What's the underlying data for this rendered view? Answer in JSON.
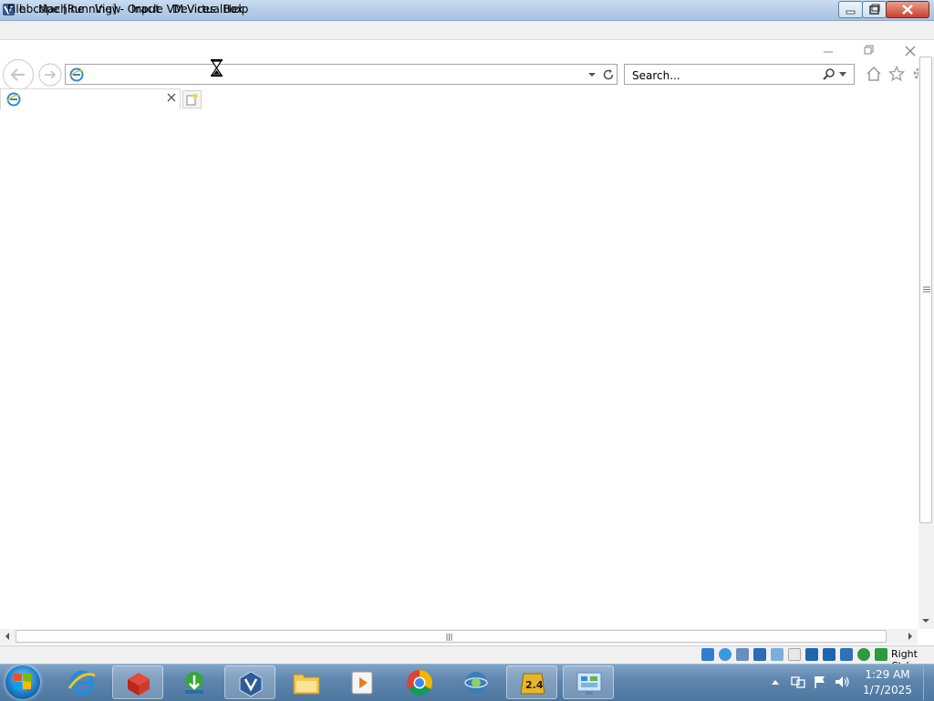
{
  "vbox": {
    "title": "hbcdpe [Running] - Oracle VM VirtualBox",
    "menu": [
      "File",
      "Machine",
      "View",
      "Input",
      "Devices",
      "Help"
    ],
    "host_key": "Right Ctrl"
  },
  "browser": {
    "address_value": "",
    "search_placeholder": "Search...",
    "tab_title": ""
  },
  "taskbar": {
    "apps": [
      "internet-explorer",
      "3d-box-app",
      "download-manager",
      "virtualbox",
      "file-explorer",
      "media-player",
      "chrome",
      "network-app",
      "app-2.4",
      "control-panel"
    ],
    "active_app_label": "2.4",
    "clock_time": "1:29 AM",
    "clock_date": "1/7/2025"
  }
}
